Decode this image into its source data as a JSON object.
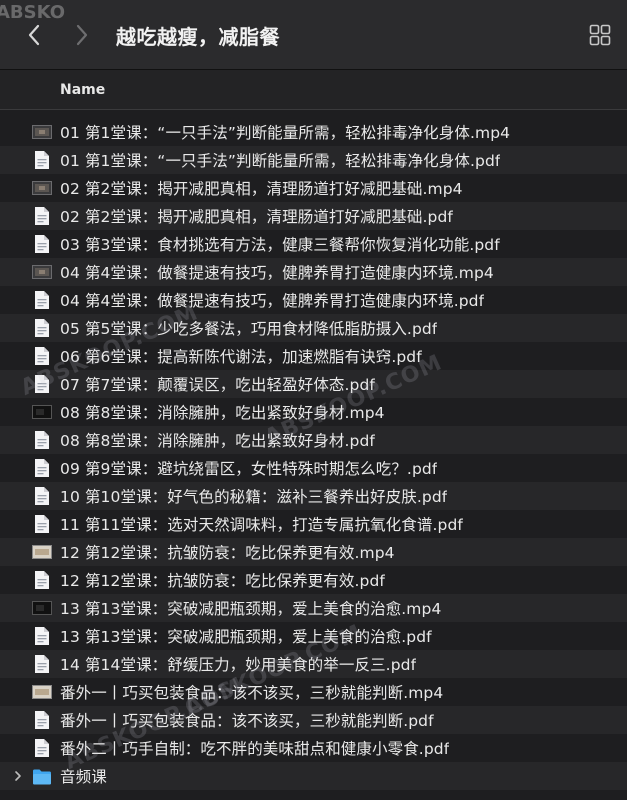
{
  "window": {
    "title": "越吃越瘦，减脂餐"
  },
  "header": {
    "column_name": "Name"
  },
  "watermark": {
    "text": "ABSKOOP.COM",
    "corner": "ABSKO"
  },
  "files": [
    {
      "name": "01 第1堂课：“一只手法”判断能量所需，轻松排毒净化身体.mp4",
      "kind": "video"
    },
    {
      "name": "01 第1堂课：“一只手法”判断能量所需，轻松排毒净化身体.pdf",
      "kind": "pdf"
    },
    {
      "name": "02 第2堂课：揭开减肥真相，清理肠道打好减肥基础.mp4",
      "kind": "video"
    },
    {
      "name": "02 第2堂课：揭开减肥真相，清理肠道打好减肥基础.pdf",
      "kind": "pdf"
    },
    {
      "name": "03 第3堂课：食材挑选有方法，健康三餐帮你恢复消化功能.pdf",
      "kind": "pdf"
    },
    {
      "name": "04 第4堂课：做餐提速有技巧，健脾养胃打造健康内环境.mp4",
      "kind": "video"
    },
    {
      "name": "04 第4堂课：做餐提速有技巧，健脾养胃打造健康内环境.pdf",
      "kind": "pdf"
    },
    {
      "name": "05 第5堂课：少吃多餐法，巧用食材降低脂肪摄入.pdf",
      "kind": "pdf"
    },
    {
      "name": "06 第6堂课：提高新陈代谢法，加速燃脂有诀窍.pdf",
      "kind": "pdf"
    },
    {
      "name": "07 第7堂课：颠覆误区，吃出轻盈好体态.pdf",
      "kind": "pdf"
    },
    {
      "name": "08 第8堂课：消除臃肿，吃出紧致好身材.mp4",
      "kind": "video-dark"
    },
    {
      "name": "08 第8堂课：消除臃肿，吃出紧致好身材.pdf",
      "kind": "pdf"
    },
    {
      "name": "09 第9堂课：避坑绕雷区，女性特殊时期怎么吃？.pdf",
      "kind": "pdf"
    },
    {
      "name": "10 第10堂课：好气色的秘籍：滋补三餐养出好皮肤.pdf",
      "kind": "pdf"
    },
    {
      "name": "11 第11堂课：选对天然调味料，打造专属抗氧化食谱.pdf",
      "kind": "pdf"
    },
    {
      "name": "12 第12堂课：抗皱防衰：吃比保养更有效.mp4",
      "kind": "video-light"
    },
    {
      "name": "12 第12堂课：抗皱防衰：吃比保养更有效.pdf",
      "kind": "pdf"
    },
    {
      "name": "13 第13堂课：突破减肥瓶颈期，爱上美食的治愈.mp4",
      "kind": "video-dark"
    },
    {
      "name": "13 第13堂课：突破减肥瓶颈期，爱上美食的治愈.pdf",
      "kind": "pdf"
    },
    {
      "name": "14 第14堂课：舒缓压力，妙用美食的举一反三.pdf",
      "kind": "pdf"
    },
    {
      "name": "番外一丨巧买包装食品：该不该买，三秒就能判断.mp4",
      "kind": "video-light"
    },
    {
      "name": "番外一丨巧买包装食品：该不该买，三秒就能判断.pdf",
      "kind": "pdf"
    },
    {
      "name": "番外二丨巧手自制：吃不胖的美味甜点和健康小零食.pdf",
      "kind": "pdf"
    },
    {
      "name": "音频课",
      "kind": "folder"
    }
  ],
  "colors": {
    "folder": "#3fa6f0",
    "pdf_page": "#f4f4f6",
    "accent_text": "#e9e9e9"
  }
}
